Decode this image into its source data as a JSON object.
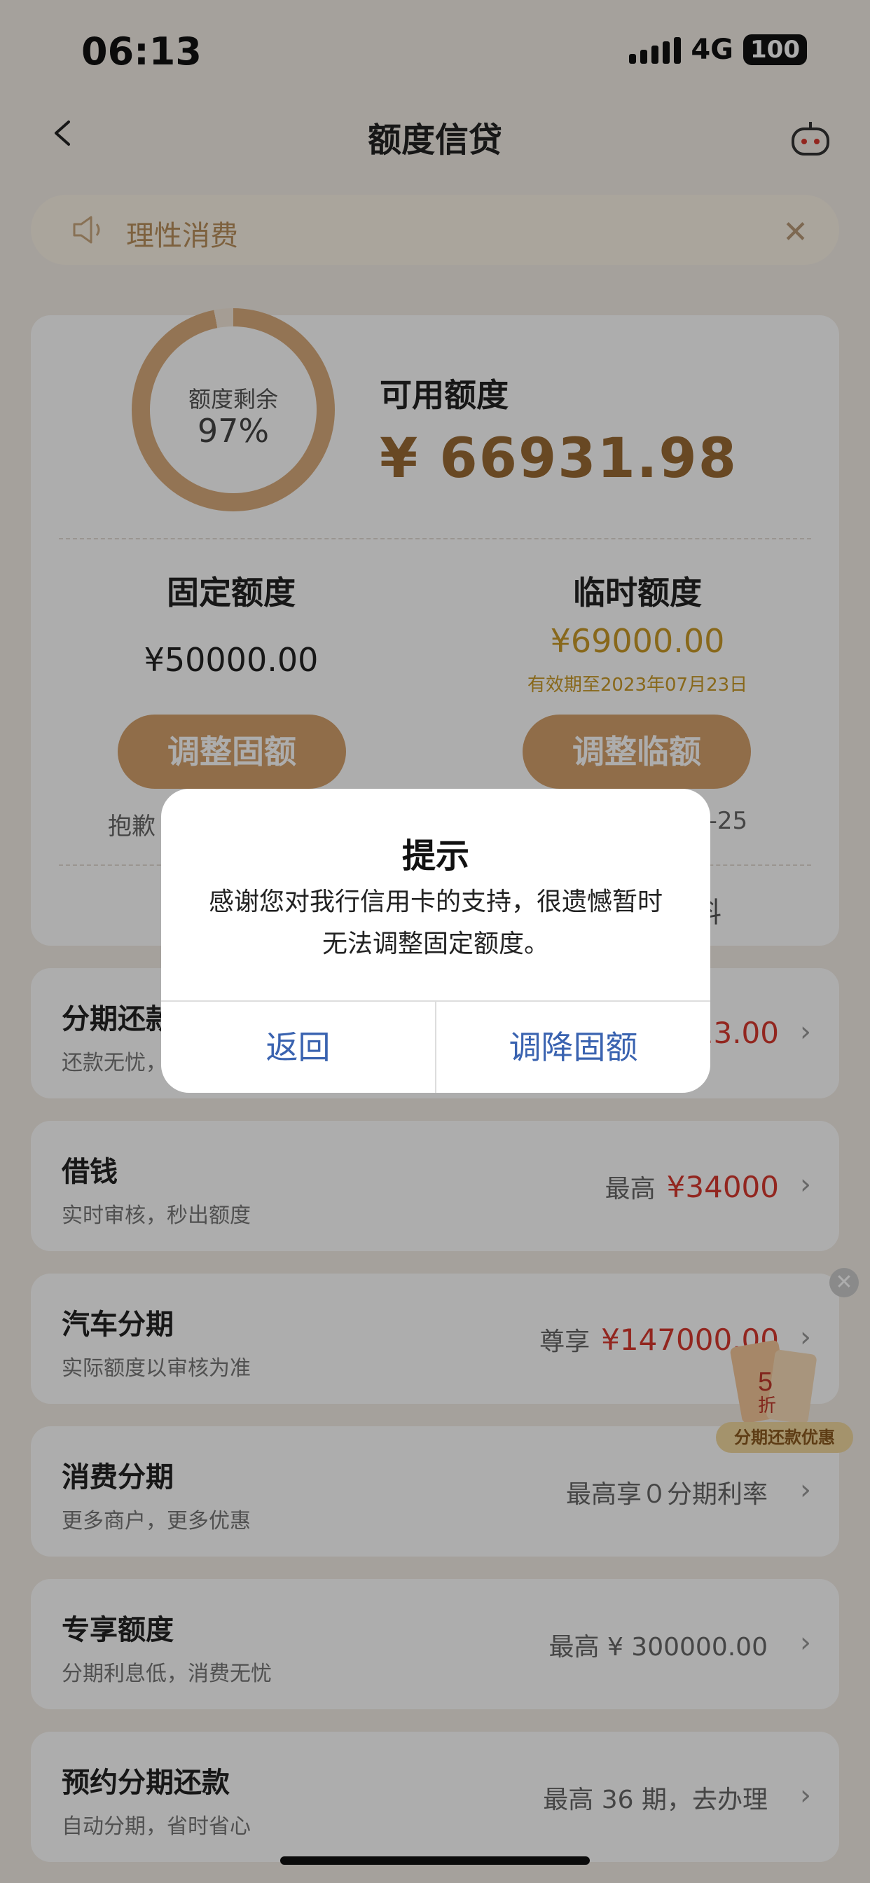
{
  "status_bar": {
    "time": "06:13",
    "network": "4G",
    "battery": "100"
  },
  "header": {
    "title": "额度信贷"
  },
  "notice": {
    "text": "理性消费"
  },
  "credit": {
    "ring_label": "额度剩余",
    "ring_percent": "97%",
    "ring_fraction": 0.97,
    "available_label": "可用额度",
    "available_value": "¥ 66931.98",
    "fixed_label": "固定额度",
    "fixed_value": "¥50000.00",
    "temp_label": "临时额度",
    "temp_value": "¥69000.00",
    "temp_valid": "有效期至2023年07月23日",
    "adjust_fixed_button": "调整固额",
    "adjust_temp_button": "调整临额",
    "sorry_partial": "抱歉",
    "temp_date_partial": "7-25",
    "below_right_partial": "料"
  },
  "list": [
    {
      "title": "分期还款",
      "subtitle": "还款无忧，",
      "right_prefix": "",
      "right_amount": "13.00"
    },
    {
      "title": "借钱",
      "subtitle": "实时审核，秒出额度",
      "right_prefix": "最高",
      "right_amount": "¥34000"
    },
    {
      "title": "汽车分期",
      "subtitle": "实际额度以审核为准",
      "right_prefix": "尊享",
      "right_amount": "¥147000.00"
    },
    {
      "title": "消费分期",
      "subtitle": "更多商户，更多优惠",
      "right_prefix": "最高享０分期利率",
      "right_amount": ""
    },
    {
      "title": "专享额度",
      "subtitle": "分期利息低，消费无忧",
      "right_prefix": "最高 ¥ 300000.00",
      "right_amount": ""
    },
    {
      "title": "预约分期还款",
      "subtitle": "自动分期，省时省心",
      "right_prefix": "最高 36 期，去办理",
      "right_amount": ""
    }
  ],
  "promo": {
    "badge": "分期还款优惠",
    "discount_number": "5",
    "discount_unit": "折"
  },
  "dialog": {
    "title": "提示",
    "message": "感谢您对我行信用卡的支持，很遗憾暂时无法调整固定额度。",
    "back_button": "返回",
    "confirm_button": "调降固额"
  },
  "colors": {
    "accent": "#d4a16c",
    "amount_red": "#d8382f",
    "gold": "#c99a28",
    "dialog_button": "#3a63b0"
  }
}
